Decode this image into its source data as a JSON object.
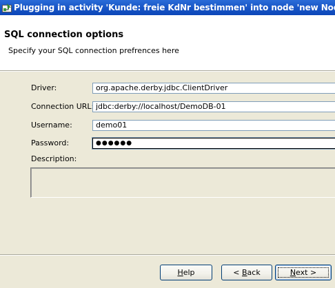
{
  "window": {
    "title": "Plugging in activity 'Kunde: freie KdNr bestimmen' into node 'new Node'"
  },
  "banner": {
    "title": "SQL connection options",
    "subtitle": "Specify your SQL connection prefrences here"
  },
  "form": {
    "driver": {
      "label": "Driver:",
      "value": "org.apache.derby.jdbc.ClientDriver"
    },
    "connection_url": {
      "label": "Connection URL:",
      "value": "jdbc:derby://localhost/DemoDB-01"
    },
    "username": {
      "label": "Username:",
      "value": "demo01"
    },
    "password": {
      "label": "Password:",
      "value": "●●●●●●"
    },
    "description": {
      "label": "Description:",
      "value": ""
    }
  },
  "buttons": {
    "help": {
      "label": "Help",
      "mnemonic": "H",
      "rest": "elp"
    },
    "back": {
      "prefix": "< ",
      "mnemonic": "B",
      "rest": "ack"
    },
    "next": {
      "mnemonic": "N",
      "rest": "ext >"
    }
  },
  "colors": {
    "title_bar": "#1b58c8",
    "dialog_background": "#ece9d8",
    "field_border": "#7f9db9",
    "button_border": "#003c74"
  },
  "icons": {
    "title_icon": "workflow-plug-icon"
  }
}
